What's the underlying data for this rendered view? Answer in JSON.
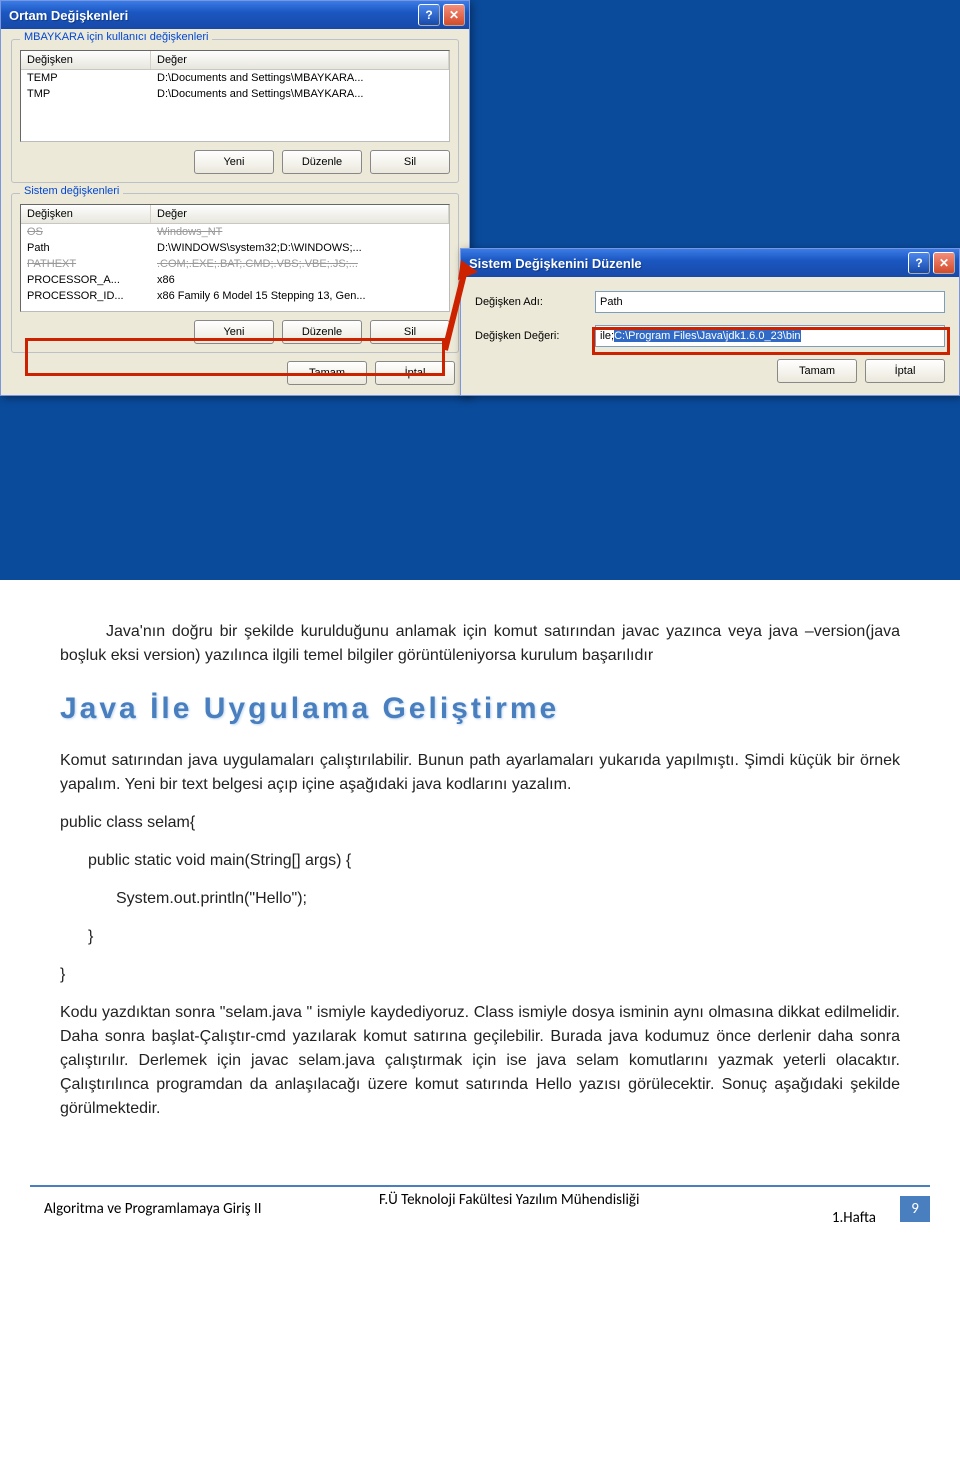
{
  "dlg_main": {
    "title": "Ortam Değişkenleri",
    "group1": {
      "legend": "MBAYKARA için kullanıcı değişkenleri",
      "cols": [
        "Değişken",
        "Değer"
      ],
      "rows": [
        [
          "TEMP",
          "D:\\Documents and Settings\\MBAYKARA..."
        ],
        [
          "TMP",
          "D:\\Documents and Settings\\MBAYKARA..."
        ]
      ]
    },
    "group2": {
      "legend": "Sistem değişkenleri",
      "cols": [
        "Değişken",
        "Değer"
      ],
      "rows": [
        [
          "OS",
          "Windows_NT"
        ],
        [
          "Path",
          "D:\\WINDOWS\\system32;D:\\WINDOWS;..."
        ],
        [
          "PATHEXT",
          ".COM;.EXE;.BAT;.CMD;.VBS;.VBE;.JS;..."
        ],
        [
          "PROCESSOR_A...",
          "x86"
        ],
        [
          "PROCESSOR_ID...",
          "x86 Family 6 Model 15 Stepping 13, Gen..."
        ]
      ]
    },
    "buttons": {
      "new": "Yeni",
      "edit": "Düzenle",
      "del": "Sil",
      "ok": "Tamam",
      "cancel": "İptal"
    }
  },
  "dlg_edit": {
    "title": "Sistem Değişkenini Düzenle",
    "name_label": "Değişken Adı:",
    "name_value": "Path",
    "val_label": "Değişken Değeri:",
    "val_prefix": "ile;",
    "val_sel": "C:\\Program Files\\Java\\jdk1.6.0_23\\bin",
    "ok": "Tamam",
    "cancel": "İptal"
  },
  "text": {
    "p1": "Java'nın doğru bir şekilde kurulduğunu anlamak için komut satırından javac yazınca veya java –version(java boşluk eksi version) yazılınca ilgili temel bilgiler görüntüleniyorsa kurulum başarılıdır",
    "heading": "Java İle Uygulama Geliştirme",
    "p2": "Komut satırından java uygulamaları çalıştırılabilir. Bunun path ayarlamaları yukarıda yapılmıştı. Şimdi küçük bir örnek yapalım. Yeni bir text belgesi açıp içine aşağıdaki java kodlarını yazalım.",
    "c1": "public class   selam{",
    "c2": "public static void main(String[] args) {",
    "c3": "System.out.println(\"Hello\");",
    "c4": "}",
    "c5": "}",
    "p3": "Kodu yazdıktan sonra  \"selam.java \" ismiyle kaydediyoruz. Class ismiyle dosya isminin aynı olmasına dikkat edilmelidir. Daha sonra başlat-Çalıştır-cmd yazılarak komut satırına geçilebilir. Burada java kodumuz önce derlenir daha sonra çalıştırılır. Derlemek için javac selam.java çalıştırmak için ise java selam komutlarını yazmak yeterli olacaktır. Çalıştırılınca programdan da anlaşılacağı üzere komut satırında Hello yazısı görülecektir. Sonuç aşağıdaki şekilde görülmektedir."
  },
  "footer": {
    "left": "Algoritma ve Programlamaya Giriş II",
    "center1": "F.Ü Teknoloji Fakültesi Yazılım Mühendisliği",
    "center2": "1.Hafta",
    "page": "9"
  }
}
